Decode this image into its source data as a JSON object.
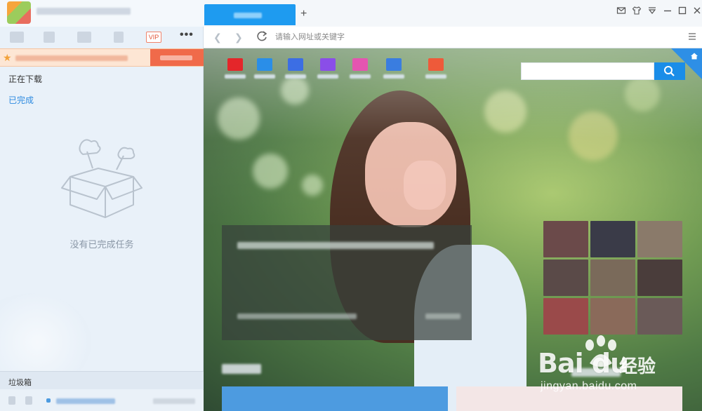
{
  "window": {
    "app_title": "",
    "vip_label": "VIP",
    "more_label": "•••"
  },
  "left_panel": {
    "tab_downloading": "正在下载",
    "tab_completed": "已完成",
    "empty_message": "没有已完成任务",
    "trash_label": "垃圾箱"
  },
  "browser": {
    "new_tab_label": "+",
    "address_placeholder": "请输入网址或关键字"
  },
  "page": {
    "search_button_icon": "search-icon",
    "site_nav_colors": [
      "#e4262a",
      "#2a8ee8",
      "#3c6ee4",
      "#8a4ee8",
      "#e455b0",
      "#3a7de0",
      "#ee5a3a"
    ],
    "thumb_colors": [
      "#6b4a4a",
      "#3a3b48",
      "#8a7a6a",
      "#5a4a48",
      "#7a6a5a",
      "#4a3d3b",
      "#9a4a4a",
      "#8a6a5a",
      "#6a5a58"
    ],
    "bottom_card_colors": [
      "#4d9be0",
      "#f3e6e6"
    ]
  },
  "watermark": {
    "brand_latin": "Bai du",
    "brand_cn": "经验",
    "url": "jingyan.baidu.com"
  },
  "colors": {
    "accent_blue": "#1e9bf0",
    "banner_orange": "#f06a4a",
    "completed_tab": "#2d8ae0"
  }
}
